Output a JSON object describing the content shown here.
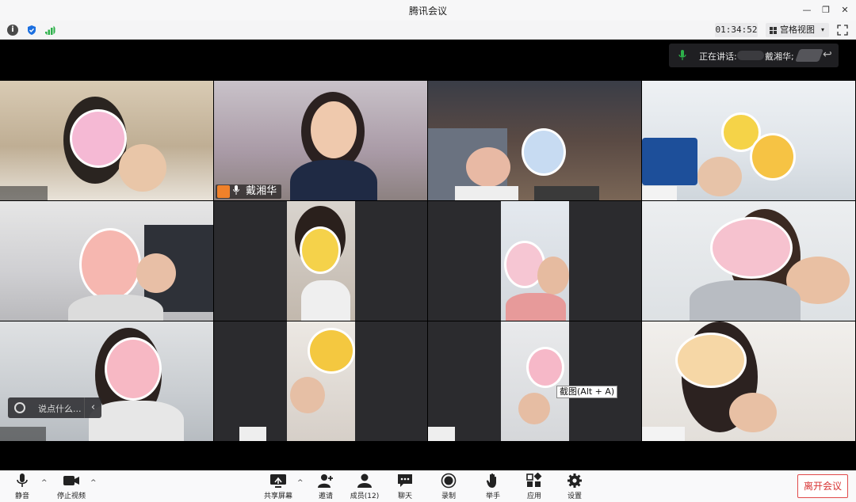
{
  "window": {
    "title": "腾讯会议",
    "minimize": "—",
    "restore": "❐",
    "close": "✕"
  },
  "infobar": {
    "timer": "01:34:52",
    "view_label": "宫格视图",
    "view_caret": "▾"
  },
  "speaking": {
    "label": "正在讲话:",
    "name": "戴湘华;"
  },
  "tiles": [
    {
      "name": ""
    },
    {
      "name": "戴湘华"
    },
    {
      "name": ""
    },
    {
      "name": ""
    },
    {
      "name": ""
    },
    {
      "name": ""
    },
    {
      "name": ""
    },
    {
      "name": ""
    },
    {
      "name": ""
    },
    {
      "name": ""
    },
    {
      "name": ""
    },
    {
      "name": ""
    }
  ],
  "chat": {
    "placeholder": "说点什么...",
    "arrow": "‹"
  },
  "tooltip": "截图(Alt + A)",
  "toolbar": {
    "mute": "静音",
    "stop_video": "停止视频",
    "share_screen": "共享屏幕",
    "invite": "邀请",
    "members": "成员(12)",
    "chat": "聊天",
    "record": "录制",
    "raise_hand": "举手",
    "apps": "应用",
    "settings": "设置",
    "leave": "离开会议",
    "caret": "^"
  },
  "colors": {
    "leave_red": "#d83333",
    "signal_green": "#2db14a",
    "shield_blue": "#1b6fe0",
    "avatar_orange": "#f0812a",
    "mic_green": "#2db14a"
  }
}
